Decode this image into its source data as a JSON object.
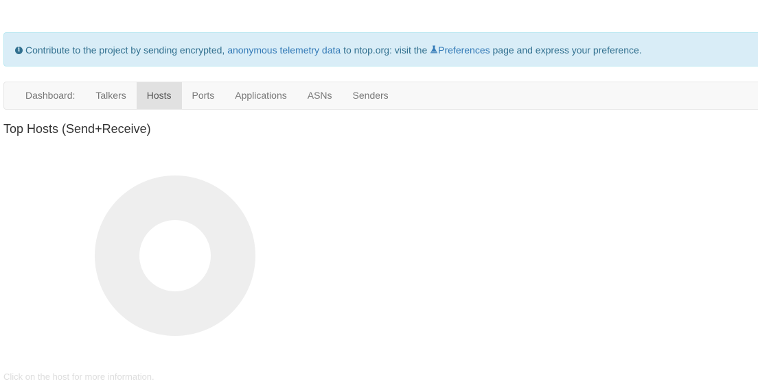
{
  "alert": {
    "text_before": "Contribute to the project by sending encrypted,",
    "telemetry_link": "anonymous telemetry data",
    "text_middle": "to ntop.org: visit the",
    "preferences_link": "Preferences",
    "text_after": "page and express your preference.",
    "icon": "info-circle-icon",
    "link_icon": "flask-icon"
  },
  "nav": {
    "brand": "Dashboard:",
    "items": [
      {
        "label": "Talkers",
        "active": false
      },
      {
        "label": "Hosts",
        "active": true
      },
      {
        "label": "Ports",
        "active": false
      },
      {
        "label": "Applications",
        "active": false
      },
      {
        "label": "ASNs",
        "active": false
      },
      {
        "label": "Senders",
        "active": false
      }
    ]
  },
  "main": {
    "title": "Top Hosts (Send+Receive)",
    "footnote": "Click on the host for more information."
  },
  "chart_data": {
    "type": "pie",
    "categories": [],
    "values": [],
    "title": "",
    "empty": true,
    "placeholder_color": "#eeeeee"
  },
  "colors": {
    "alert_bg": "#d9edf7",
    "alert_text": "#31708f",
    "link": "#337ab7",
    "nav_active_bg": "#e1e1e1"
  }
}
